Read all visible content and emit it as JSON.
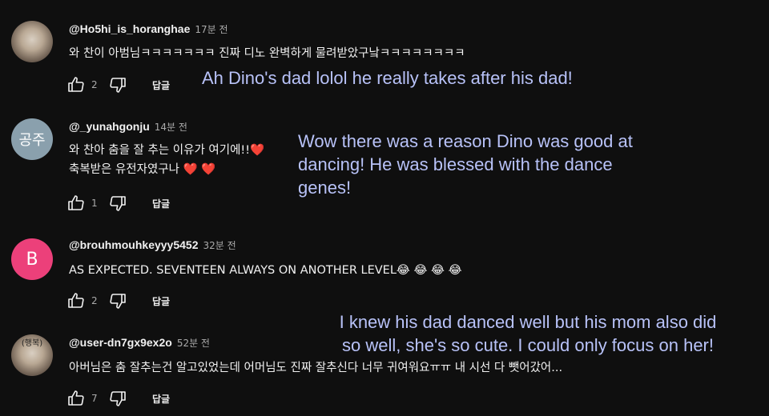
{
  "comments": [
    {
      "author": "@Ho5hi_is_horanghae",
      "time": "17분 전",
      "avatar_type": "photo",
      "lines": [
        "와 찬이 아범님ㅋㅋㅋㅋㅋㅋㅋ 진짜 디노 완벽하게 물려받았구낰ㅋㅋㅋㅋㅋㅋㅋㅋ"
      ],
      "likes": "2",
      "reply_label": "답글"
    },
    {
      "author": "@_yunahgonju",
      "time": "14분 전",
      "avatar_type": "letters",
      "avatar_text": "공주",
      "avatar_color": "#8aa0ad",
      "lines": [
        "와 찬아 춤을 잘 추는 이유가 여기에!!❤️",
        "축복받은 유전자였구나 ❤️ ❤️"
      ],
      "likes": "1",
      "reply_label": "답글"
    },
    {
      "author": "@brouhmouhkeyyy5452",
      "time": "32분 전",
      "avatar_type": "letter",
      "avatar_text": "B",
      "avatar_color": "#ec407a",
      "lines": [
        "AS EXPECTED. SEVENTEEN ALWAYS ON ANOTHER LEVEL😂 😂 😂 😂"
      ],
      "likes": "2",
      "reply_label": "답글"
    },
    {
      "author": "@user-dn7gx9ex2o",
      "time": "52분 전",
      "avatar_type": "photo",
      "avatar_badge": "(행복)",
      "lines": [
        "아버님은 춤 잘추는건 알고있었는데 어머님도 진짜 잘추신다 너무 귀여워요ㅠㅠ 내 시선 다 뺏어갔어..."
      ],
      "likes": "7",
      "reply_label": "답글"
    }
  ],
  "translations": [
    {
      "lines": [
        "Ah Dino's dad lolol he really takes after his dad!"
      ]
    },
    {
      "lines": [
        "Wow there was a reason Dino was good at",
        "dancing! He was blessed with the dance",
        "genes!"
      ]
    },
    {
      "lines": [
        "I knew his dad danced well but his mom also did",
        "so well, she's so cute. I could only focus on her!"
      ]
    }
  ],
  "icons": {
    "like": "thumbs-up-icon",
    "dislike": "thumbs-down-icon"
  },
  "colors": {
    "background": "#0f0f0f",
    "text": "#f1f1f1",
    "secondary_text": "#aaaaaa",
    "overlay_text": "#b8c2f8"
  }
}
